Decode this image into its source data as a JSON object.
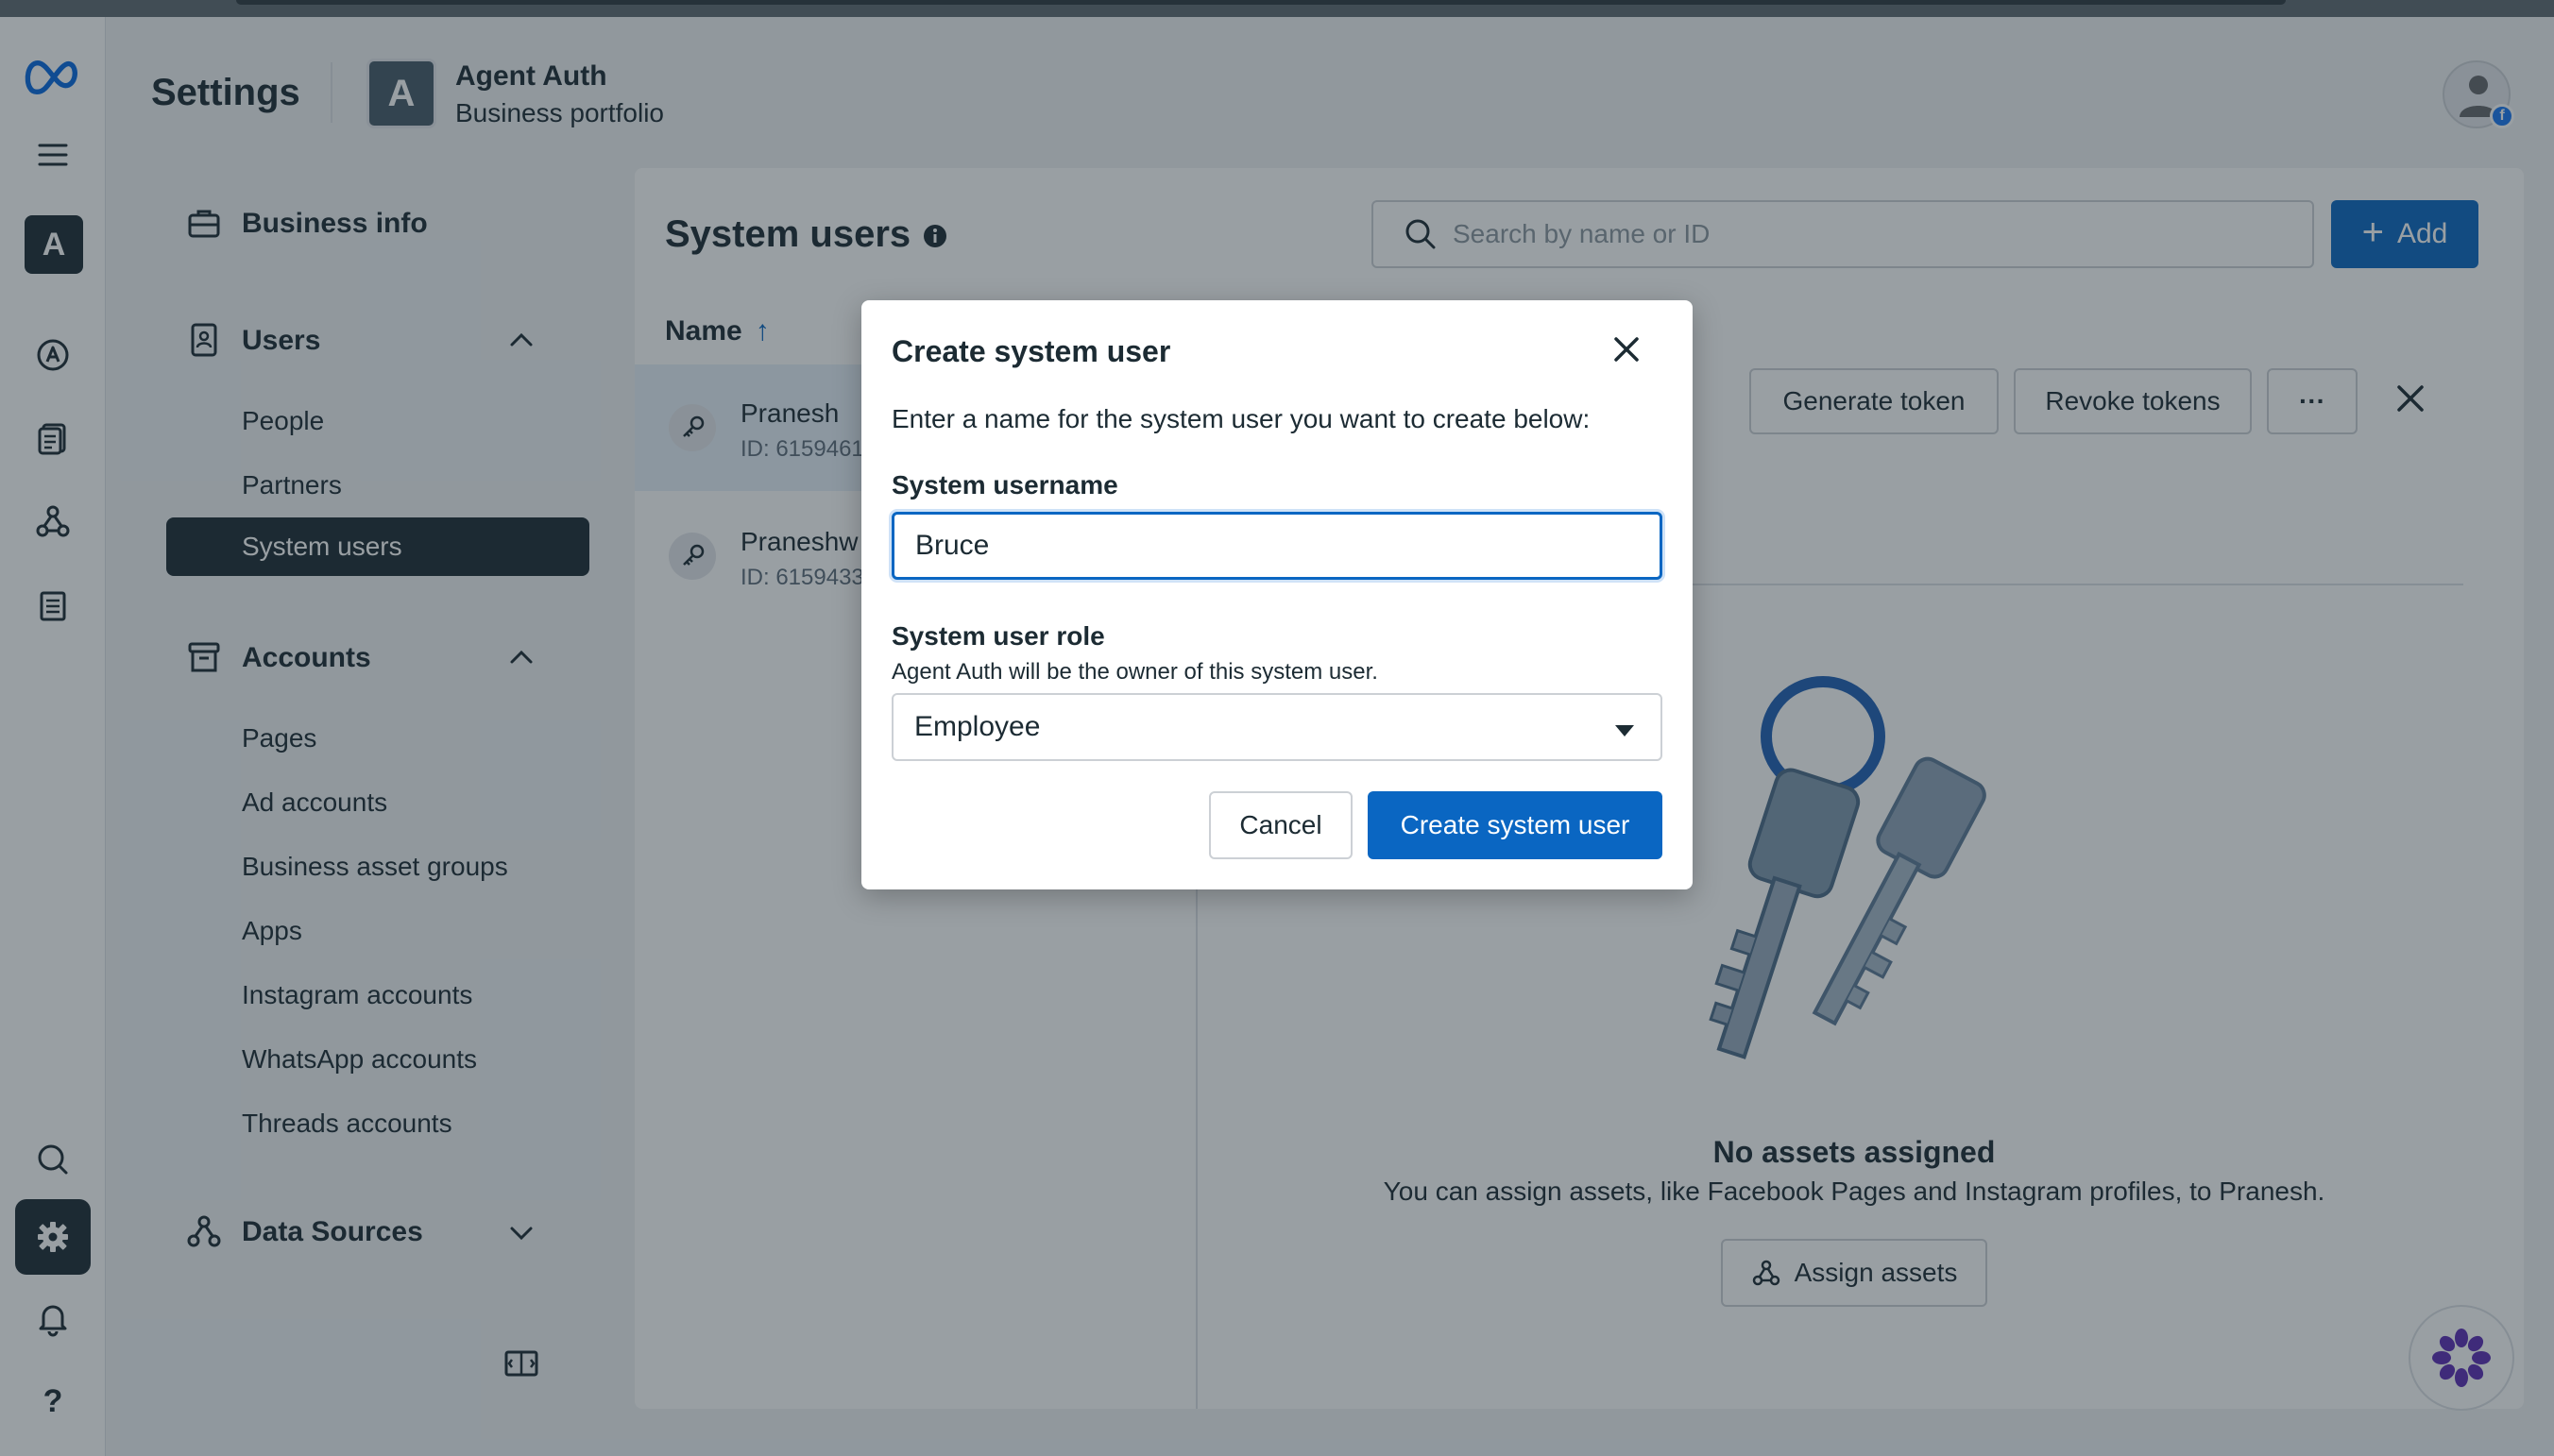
{
  "header": {
    "title": "Settings",
    "portfolio_initial": "A",
    "portfolio_name": "Agent Auth",
    "portfolio_subtitle": "Business portfolio"
  },
  "rail": {
    "avatar_initial": "A",
    "help_label": "?"
  },
  "nav": {
    "business_info": "Business info",
    "users_section": "Users",
    "users_items": [
      "People",
      "Partners",
      "System users"
    ],
    "accounts_section": "Accounts",
    "accounts_items": [
      "Pages",
      "Ad accounts",
      "Business asset groups",
      "Apps",
      "Instagram accounts",
      "WhatsApp accounts",
      "Threads accounts"
    ],
    "data_sources_section": "Data Sources"
  },
  "main": {
    "title": "System users",
    "search_placeholder": "Search by name or ID",
    "add_label": "Add",
    "column_name": "Name",
    "rows": [
      {
        "name": "Pranesh",
        "id": "ID: 6159461"
      },
      {
        "name": "Praneshw",
        "id": "ID: 6159433"
      }
    ],
    "generate_token": "Generate token",
    "revoke_tokens": "Revoke tokens",
    "more_label": "···",
    "empty_title": "No assets assigned",
    "empty_subtitle": "You can assign assets, like Facebook Pages and Instagram profiles, to Pranesh.",
    "assign_assets": "Assign assets"
  },
  "modal": {
    "title": "Create system user",
    "description": "Enter a name for the system user you want to create below:",
    "username_label": "System username",
    "username_value": "Bruce",
    "role_label": "System user role",
    "role_help": "Agent Auth will be the owner of this system user.",
    "role_value": "Employee",
    "cancel_label": "Cancel",
    "create_label": "Create system user"
  },
  "colors": {
    "primary": "#0a66c2",
    "dark": "#1c2b33",
    "background": "#f0f2f5"
  }
}
